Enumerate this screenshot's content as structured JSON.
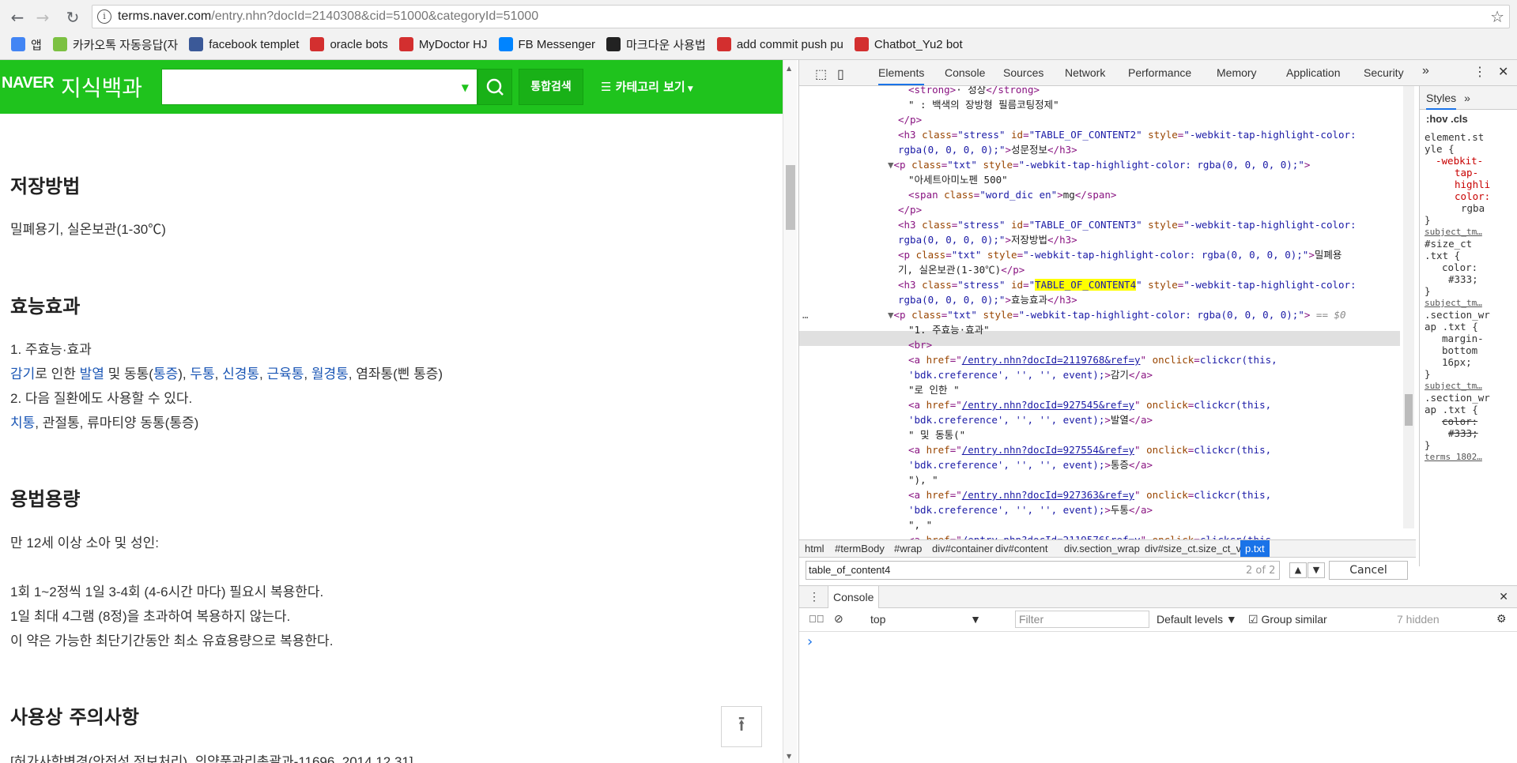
{
  "browser": {
    "url_host": "terms.naver.com",
    "url_path": "/entry.nhn?docId=2140308&cid=51000&categoryId=51000"
  },
  "bookmarks": [
    {
      "label": "앱",
      "color": "#4285f4"
    },
    {
      "label": "카카오톡 자동응답(자",
      "color": "#7cc142"
    },
    {
      "label": "facebook templet",
      "color": "#3b5998"
    },
    {
      "label": "oracle bots",
      "color": "#d32f2f"
    },
    {
      "label": "MyDoctor HJ",
      "color": "#d32f2f"
    },
    {
      "label": "FB Messenger",
      "color": "#0084ff"
    },
    {
      "label": "마크다운 사용법",
      "color": "#222222"
    },
    {
      "label": "add commit push pu",
      "color": "#d32f2f"
    },
    {
      "label": "Chatbot_Yu2 bot",
      "color": "#d32f2f"
    }
  ],
  "naver": {
    "logo": "NAVER",
    "service": "지식백과",
    "integrated_search": "통합검색",
    "category": "카테고리 보기"
  },
  "article": {
    "h_storage": "저장방법",
    "storage_text": "밀폐용기, 실온보관(1-30℃)",
    "h_efficacy": "효능효과",
    "eff1": "1. 주효능·효과",
    "eff_line": [
      {
        "t": "감기",
        "link": true
      },
      {
        "t": "로 인한 ",
        "link": false
      },
      {
        "t": "발열",
        "link": true
      },
      {
        "t": " 및 동통(",
        "link": false
      },
      {
        "t": "통증",
        "link": true
      },
      {
        "t": "), ",
        "link": false
      },
      {
        "t": "두통",
        "link": true
      },
      {
        "t": ", ",
        "link": false
      },
      {
        "t": "신경통",
        "link": true
      },
      {
        "t": ", ",
        "link": false
      },
      {
        "t": "근육통",
        "link": true
      },
      {
        "t": ", ",
        "link": false
      },
      {
        "t": "월경통",
        "link": true
      },
      {
        "t": ", 염좌통(삔 통증)",
        "link": false
      }
    ],
    "eff2": "2. 다음 질환에도 사용할 수 있다.",
    "eff3_link": "치통",
    "eff3_rest": ", 관절통, 류마티양 동통(통증)",
    "h_dosage": "용법용량",
    "dose1": "만 12세 이상 소아 및 성인:",
    "dose2": "1회 1~2정씩 1일 3-4회 (4-6시간 마다) 필요시 복용한다.",
    "dose3": "1일 최대 4그램 (8정)을 초과하여 복용하지 않는다.",
    "dose4": "이 약은 가능한 최단기간동안 최소 유효용량으로 복용한다.",
    "h_caution": "사용상 주의사항",
    "caution1": "[허가사항변경(안전성 정보처리), 의약품관리총괄과-11696, 2014.12.31]"
  },
  "devtools": {
    "tabs": [
      "Elements",
      "Console",
      "Sources",
      "Network",
      "Performance",
      "Memory",
      "Application",
      "Security"
    ],
    "styles_tab": "Styles",
    "hov": ":hov",
    "cls": ".cls",
    "styles": [
      "element.st",
      "yle {",
      "-webkit-",
      "tap-",
      "highli",
      "color:",
      "rgba",
      "}",
      "subject_tm…",
      "#size_ct",
      ".txt {",
      "color:",
      "#333;",
      "}",
      "subject_tm…",
      ".section_wr",
      "ap .txt {",
      "margin-",
      "bottom",
      "16px;",
      "}",
      "subject_tm…",
      ".section_wr",
      "ap .txt {",
      "color:",
      "#333;",
      "}",
      "terms 1802…"
    ],
    "crumbs": [
      "html",
      "#termBody",
      "#wrap",
      "div#container",
      "div#content",
      "div.section_wrap",
      "div#size_ct.size_ct_v2",
      "p.txt"
    ],
    "search_value": "table_of_content4",
    "search_count": "2 of 2",
    "cancel": "Cancel",
    "drawer_tab": "Console",
    "context": "top",
    "filter_placeholder": "Filter",
    "levels": "Default levels",
    "group_similar": "Group similar",
    "hidden": "7 hidden",
    "prompt": "›",
    "dom": {
      "l0a": "<strong>",
      "l0b": "· 성상",
      "l0c": "</strong>",
      "l1": "\" : 백색의 장방형 필름코팅정제\"",
      "l2": "</p>",
      "h3_2_id": "TABLE_OF_CONTENT2",
      "h3_2_txt": "성문정보",
      "style_val": "-webkit-tap-highlight-color:",
      "rgba": "rgba(0, 0, 0, 0);",
      "p_txt": "아세트아미노펜 500",
      "span_cls": "word_dic en",
      "span_txt": "mg",
      "h3_3_id": "TABLE_OF_CONTENT3",
      "h3_3_txt": "저장방법",
      "p3_txt": "밀폐용",
      "p3_txt2": "기, 실온보관(1-30℃)",
      "h3_4_id": "TABLE_OF_CONTENT4",
      "h3_4_txt": "효능효과",
      "sel_eq": "== $0",
      "t1": "\"1. 주효능·효과\"",
      "a1": "/entry.nhn?docId=2119768&ref=y",
      "a1t": "감기",
      "t2": "\"로 인한 \"",
      "a2": "/entry.nhn?docId=927545&ref=y",
      "a2t": "발열",
      "t3": "\" 및 동통(\"",
      "a3": "/entry.nhn?docId=927554&ref=y",
      "a3t": "통증",
      "t4": "\"), \"",
      "a4": "/entry.nhn?docId=927363&ref=y",
      "a4t": "두통",
      "t5": "\", \"",
      "a5": "/entry.nhn?docId=2119576&ref=y",
      "onclick": "clickcr(this,",
      "onclick2": "'bdk.creference', '', '', event);"
    }
  }
}
